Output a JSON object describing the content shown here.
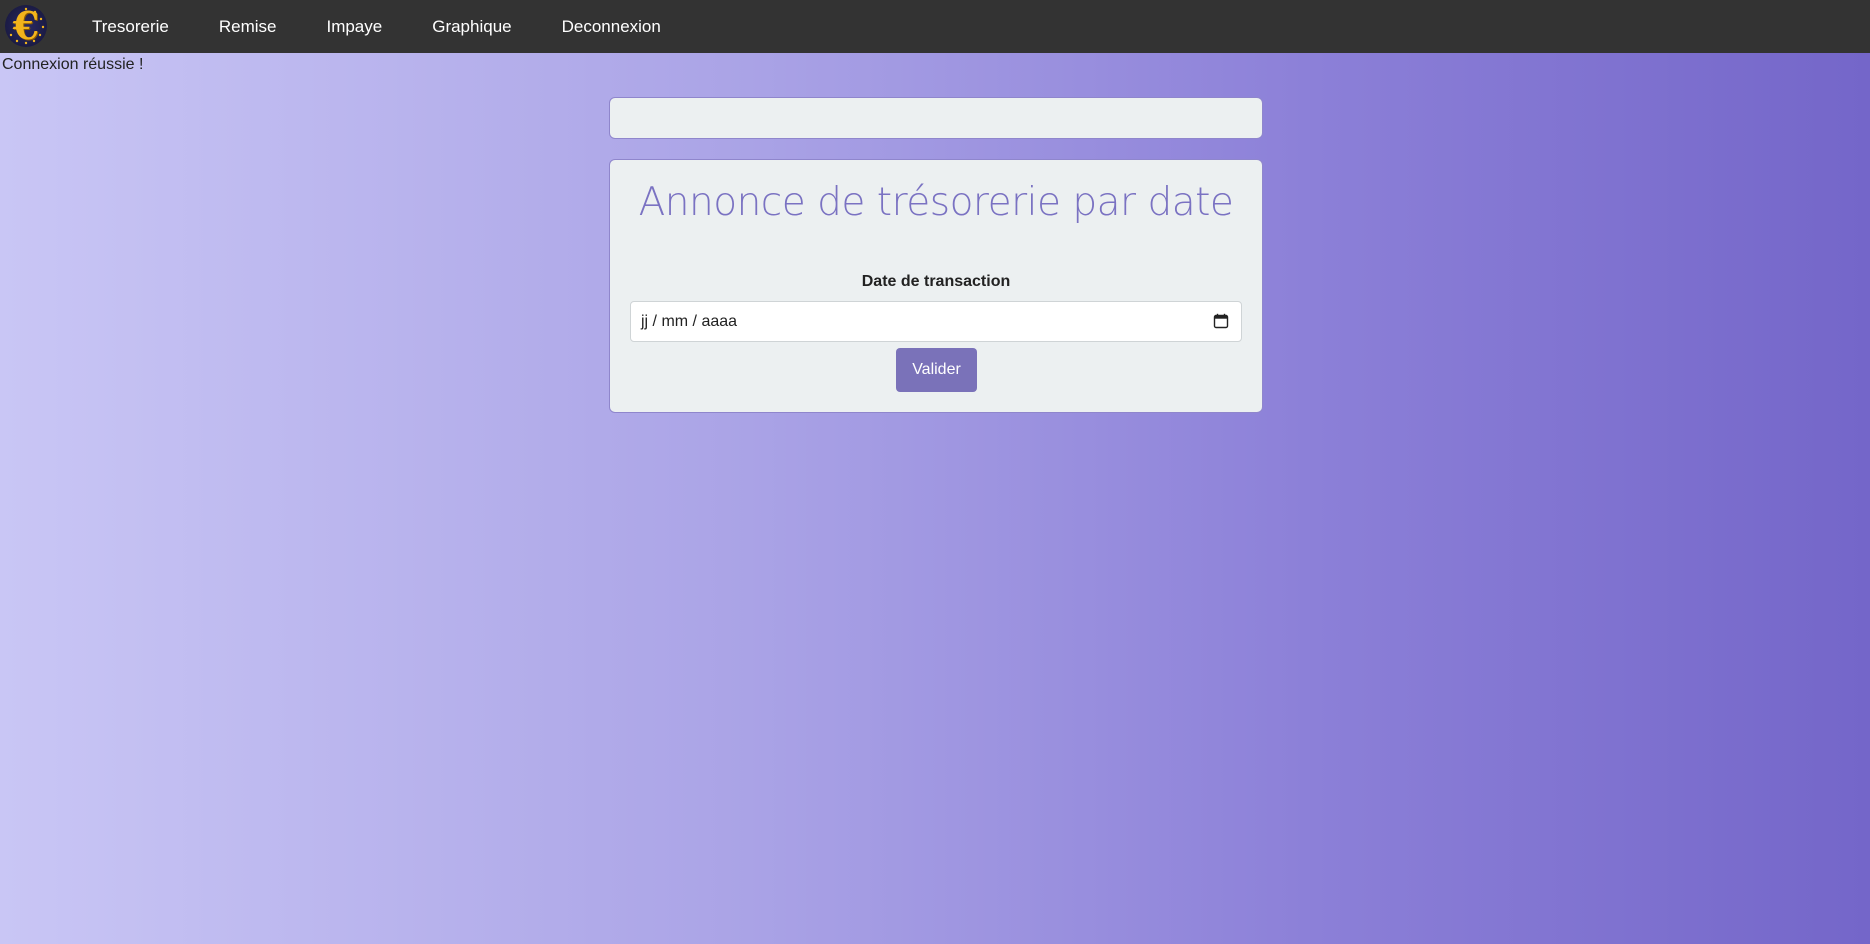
{
  "nav": {
    "items": [
      {
        "label": "Tresorerie"
      },
      {
        "label": "Remise"
      },
      {
        "label": "Impaye"
      },
      {
        "label": "Graphique"
      },
      {
        "label": "Deconnexion"
      }
    ]
  },
  "flash": {
    "message": "Connexion réussie !"
  },
  "form": {
    "title": "Annonce de trésorerie par date",
    "field_label": "Date de transaction",
    "date_placeholder": "jj / mm / aaaa",
    "submit_label": "Valider"
  },
  "colors": {
    "navbar": "#333333",
    "card": "#ecf0f1",
    "title": "#7a72c2",
    "button": "#7a72b9",
    "logo": "#f2b41c"
  },
  "icons": {
    "logo": "euro-logo-icon",
    "date_picker": "calendar-icon"
  }
}
